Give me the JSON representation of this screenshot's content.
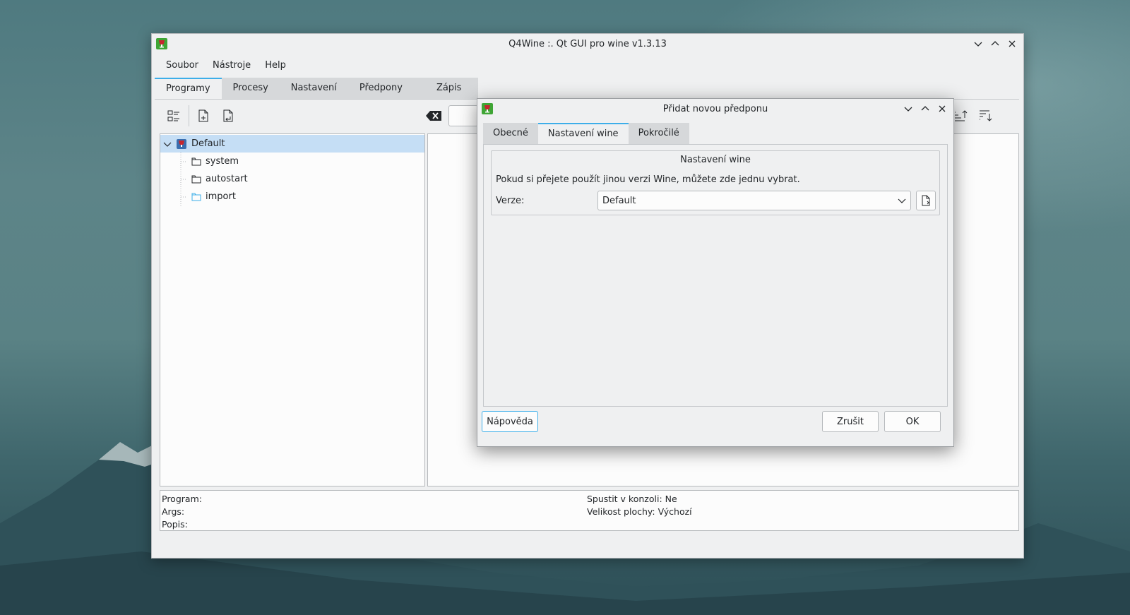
{
  "main_window": {
    "title": "Q4Wine :. Qt GUI pro wine v1.3.13",
    "menu": [
      "Soubor",
      "Nástroje",
      "Help"
    ],
    "tabs": [
      "Programy",
      "Procesy",
      "Nastavení",
      "Předpony",
      "Zápis"
    ],
    "tree": [
      {
        "label": "Default",
        "icon": "wine-glass-icon"
      },
      {
        "label": "system",
        "icon": "folder-icon"
      },
      {
        "label": "autostart",
        "icon": "folder-icon"
      },
      {
        "label": "import",
        "icon": "folder-icon"
      }
    ],
    "info": {
      "program": "Program:",
      "args": "Args:",
      "popis": "Popis:",
      "console": "Spustit v konzoli: Ne",
      "desktop": "Velikost plochy: Výchozí"
    }
  },
  "dialog": {
    "title": "Přidat novou předponu",
    "tabs": [
      "Obecné",
      "Nastavení wine",
      "Pokročilé"
    ],
    "group_title": "Nastavení wine",
    "description": "Pokud si přejete použít jinou verzi Wine, můžete zde jednu vybrat.",
    "version_label": "Verze:",
    "version_value": "Default",
    "help_button": "Nápověda",
    "cancel_button": "Zrušit",
    "ok_button": "OK"
  },
  "colors": {
    "accent": "#3daee9",
    "selection": "#c5def5",
    "window_bg": "#eff0f1"
  }
}
